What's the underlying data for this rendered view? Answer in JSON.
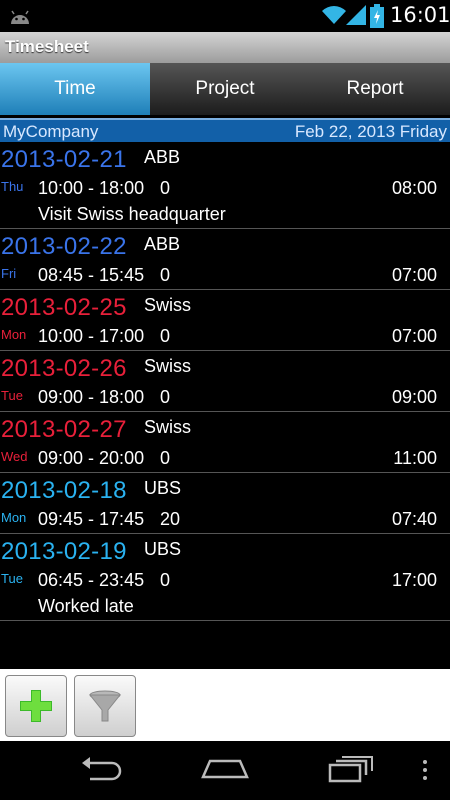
{
  "status": {
    "time": "16:01"
  },
  "app": {
    "title": "Timesheet"
  },
  "tabs": [
    {
      "label": "Time",
      "active": true
    },
    {
      "label": "Project",
      "active": false
    },
    {
      "label": "Report",
      "active": false
    }
  ],
  "header": {
    "company": "MyCompany",
    "date": "Feb 22, 2013 Friday"
  },
  "colors": {
    "blue": "#3a74ea",
    "red": "#e8203a",
    "cyan": "#2ab2f0",
    "active_tab": "#3fa6e0",
    "info_bar": "#1260a8"
  },
  "entries": [
    {
      "date": "2013-02-21",
      "weekday": "Thu",
      "project": "ABB",
      "time": "10:00 - 18:00",
      "pause": "0",
      "duration": "08:00",
      "note": "Visit Swiss headquarter",
      "color": "blue"
    },
    {
      "date": "2013-02-22",
      "weekday": "Fri",
      "project": "ABB",
      "time": "08:45 - 15:45",
      "pause": "0",
      "duration": "07:00",
      "note": "",
      "color": "blue"
    },
    {
      "date": "2013-02-25",
      "weekday": "Mon",
      "project": "Swiss",
      "time": "10:00 - 17:00",
      "pause": "0",
      "duration": "07:00",
      "note": "",
      "color": "red"
    },
    {
      "date": "2013-02-26",
      "weekday": "Tue",
      "project": "Swiss",
      "time": "09:00 - 18:00",
      "pause": "0",
      "duration": "09:00",
      "note": "",
      "color": "red"
    },
    {
      "date": "2013-02-27",
      "weekday": "Wed",
      "project": "Swiss",
      "time": "09:00 - 20:00",
      "pause": "0",
      "duration": "11:00",
      "note": "",
      "color": "red"
    },
    {
      "date": "2013-02-18",
      "weekday": "Mon",
      "project": "UBS",
      "time": "09:45 - 17:45",
      "pause": "20",
      "duration": "07:40",
      "note": "",
      "color": "cyan"
    },
    {
      "date": "2013-02-19",
      "weekday": "Tue",
      "project": "UBS",
      "time": "06:45 - 23:45",
      "pause": "0",
      "duration": "17:00",
      "note": "Worked late",
      "color": "cyan"
    }
  ],
  "icons": {
    "add": "plus-icon",
    "filter": "funnel-icon",
    "back": "back-icon",
    "home": "home-icon",
    "recents": "recents-icon",
    "menu": "overflow-menu-icon"
  }
}
